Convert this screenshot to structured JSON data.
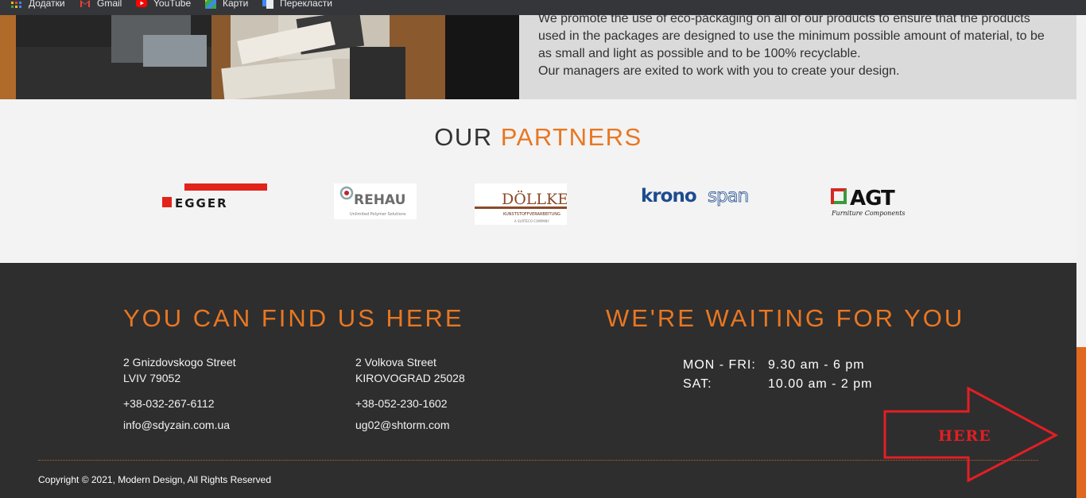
{
  "bookmarks": [
    {
      "label": "Додатки",
      "icon": "apps-grid-icon"
    },
    {
      "label": "Gmail",
      "icon": "gmail-icon"
    },
    {
      "label": "YouTube",
      "icon": "youtube-icon"
    },
    {
      "label": "Карти",
      "icon": "maps-icon"
    },
    {
      "label": "Перекласти",
      "icon": "translate-icon"
    }
  ],
  "hero": {
    "lines": [
      "We promote the use of eco-packaging on all of our products to ensure that the products",
      "used in the packages are designed to use the minimum possible amount of material, to be",
      "as small and light as possible and to be 100% recyclable.",
      "Our managers are exited to work with you to create your design."
    ]
  },
  "partners": {
    "title_dark": "OUR",
    "title_accent": "PARTNERS",
    "logos": [
      {
        "name": "EGGER"
      },
      {
        "name": "REHAU",
        "tagline": "Unlimited Polymer Solutions"
      },
      {
        "name": "DÖLLKEN",
        "tagline": "KUNSTSTOFFVERARBEITUNG",
        "sub": "A SURTECO COMPANY"
      },
      {
        "name_a": "krono",
        "name_b": "span"
      },
      {
        "name": "AGT",
        "tagline": "Furniture Components"
      }
    ]
  },
  "footer": {
    "find_heading": "YOU CAN FIND US HERE",
    "wait_heading": "WE'RE WAITING FOR YOU",
    "locations": [
      {
        "street": "2 Gnizdovskogo Street",
        "city": "LVIV 79052",
        "phone": "+38-032-267-6112",
        "email": "info@sdyzain.com.ua"
      },
      {
        "street": "2 Volkova Street",
        "city": "KIROVOGRAD 25028",
        "phone": "+38-052-230-1602",
        "email": "ug02@shtorm.com"
      }
    ],
    "hours": [
      {
        "days": "MON - FRI:",
        "time": "9.30 am - 6 pm"
      },
      {
        "days": "SAT:",
        "time": "10.00 am - 2 pm"
      }
    ],
    "copyright": "Copyright © 2021, Modern Design, All Rights Reserved"
  },
  "annotation": {
    "label": "HERE",
    "color": "#e31e24"
  },
  "colors": {
    "accent": "#e87722",
    "footer_bg": "#2e2e2e",
    "hero_bg": "#dadada",
    "scrollbar_thumb": "#e0691f"
  }
}
